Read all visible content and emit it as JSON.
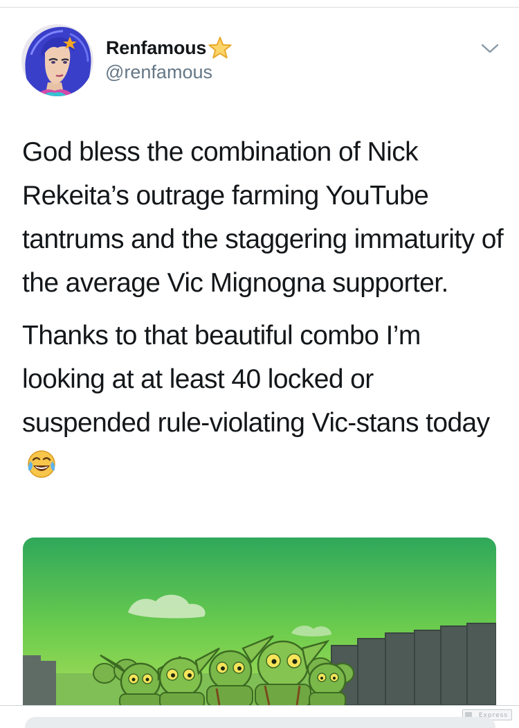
{
  "tweet": {
    "display_name": "Renfamous",
    "handle": "@renfamous",
    "badge_icon": "star-icon",
    "menu_icon": "chevron-down-icon",
    "paragraphs": [
      "God bless the combination of Nick Rekeita’s outrage farming YouTube tantrums and the staggering immaturity of the average Vic Mignogna supporter.",
      "Thanks to that beautiful combo I’m looking at at least 40 locked or suspended rule-violating Vic-stans today"
    ],
    "emoji": "face-with-tears-of-joy-emoji",
    "media": "image-green-goblins-in-front-of-wall"
  },
  "watermark": {
    "text": "Express"
  },
  "colors": {
    "text": "#14171a",
    "secondary_text": "#657786",
    "divider": "#d9dde1",
    "sky": "#46b84a",
    "goblin": "#6fb33a"
  }
}
